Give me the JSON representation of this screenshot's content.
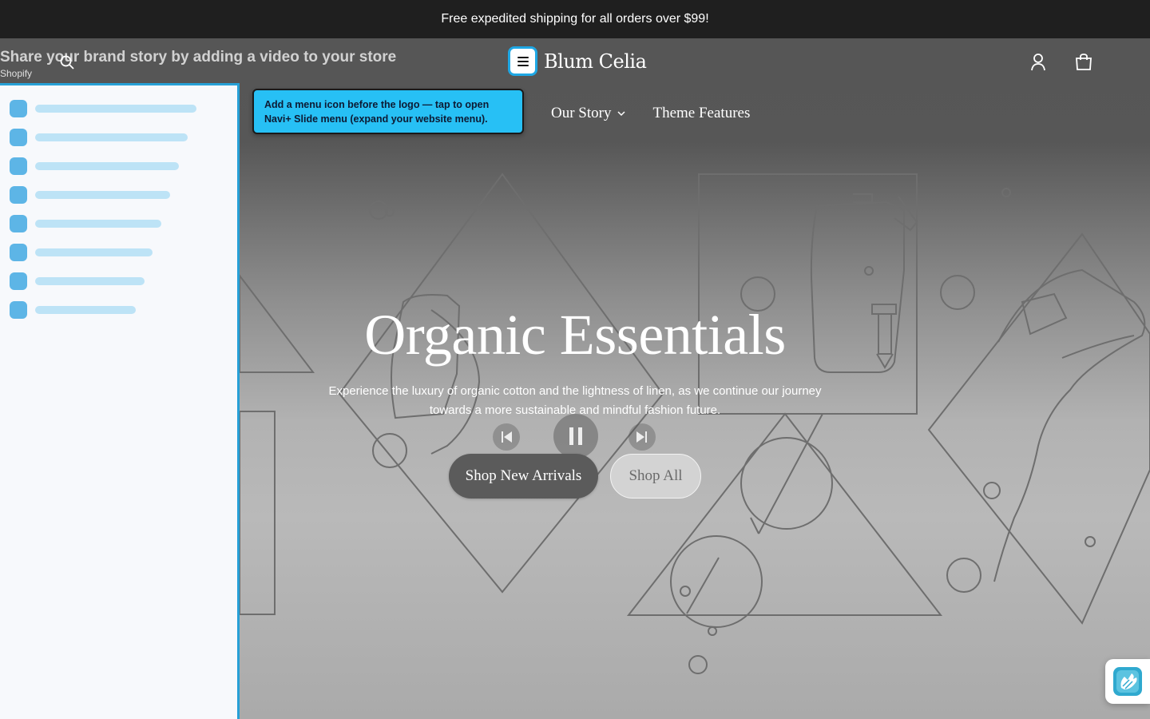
{
  "announcement": {
    "text": "Free expedited shipping for all orders over $99!"
  },
  "video_overlay": {
    "title": "Share your brand story by adding a video to your store",
    "source": "Shopify"
  },
  "header": {
    "brand": "Blum Celia",
    "icons": {
      "search": "search-icon",
      "menu": "hamburger-menu-icon",
      "account": "user-account-icon",
      "cart": "shopping-bag-icon"
    },
    "nav": [
      {
        "label": "Our Story",
        "has_dropdown": true
      },
      {
        "label": "Theme Features",
        "has_dropdown": false
      }
    ]
  },
  "tooltip": {
    "text": "Add a menu icon before the logo — tap to open Navi+ Slide menu (expand your website menu)."
  },
  "drawer": {
    "item_count": 8,
    "accent_color": "#27a0d6",
    "placeholder_color": "#bde3f6"
  },
  "hero": {
    "title": "Organic Essentials",
    "text": "Experience the luxury of organic cotton and the lightness of linen, as we continue our journey towards a more sustainable and mindful fashion future.",
    "primary_button": "Shop New Arrivals",
    "secondary_button": "Shop All"
  },
  "video_controls": {
    "icons": [
      "previous-icon",
      "pause-icon",
      "next-icon"
    ]
  },
  "widget": {
    "icon": "hand-wave-icon"
  },
  "colors": {
    "announcement_bg": "#1f1f1f",
    "accent": "#27c0f5",
    "menu_border": "#1ea7e4"
  }
}
